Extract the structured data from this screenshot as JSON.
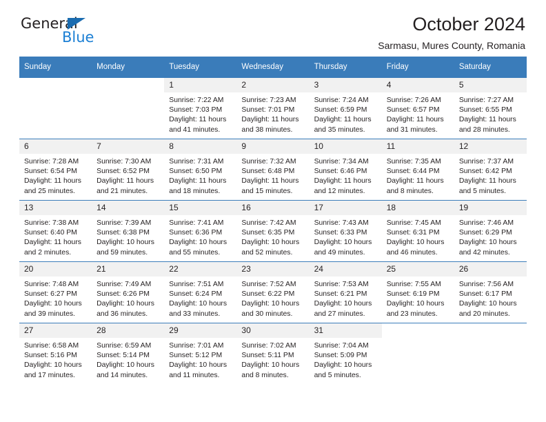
{
  "brand": {
    "name_part1": "General",
    "name_part2": "Blue",
    "triangle_color": "#1b6cb0",
    "blue_text_color": "#1b7fd4"
  },
  "header": {
    "title": "October 2024",
    "location": "Sarmasu, Mures County, Romania"
  },
  "theme": {
    "header_bg": "#3a7cba",
    "daynum_bg": "#f1f1f1",
    "grid_line": "#3a7cba",
    "text": "#231f20"
  },
  "calendar": {
    "weekday_headers": [
      "Sunday",
      "Monday",
      "Tuesday",
      "Wednesday",
      "Thursday",
      "Friday",
      "Saturday"
    ],
    "weeks": [
      [
        {
          "day": "",
          "blank": true,
          "lines": []
        },
        {
          "day": "",
          "blank": true,
          "lines": []
        },
        {
          "day": "1",
          "lines": [
            "Sunrise: 7:22 AM",
            "Sunset: 7:03 PM",
            "Daylight: 11 hours",
            "and 41 minutes."
          ]
        },
        {
          "day": "2",
          "lines": [
            "Sunrise: 7:23 AM",
            "Sunset: 7:01 PM",
            "Daylight: 11 hours",
            "and 38 minutes."
          ]
        },
        {
          "day": "3",
          "lines": [
            "Sunrise: 7:24 AM",
            "Sunset: 6:59 PM",
            "Daylight: 11 hours",
            "and 35 minutes."
          ]
        },
        {
          "day": "4",
          "lines": [
            "Sunrise: 7:26 AM",
            "Sunset: 6:57 PM",
            "Daylight: 11 hours",
            "and 31 minutes."
          ]
        },
        {
          "day": "5",
          "lines": [
            "Sunrise: 7:27 AM",
            "Sunset: 6:55 PM",
            "Daylight: 11 hours",
            "and 28 minutes."
          ]
        }
      ],
      [
        {
          "day": "6",
          "lines": [
            "Sunrise: 7:28 AM",
            "Sunset: 6:54 PM",
            "Daylight: 11 hours",
            "and 25 minutes."
          ]
        },
        {
          "day": "7",
          "lines": [
            "Sunrise: 7:30 AM",
            "Sunset: 6:52 PM",
            "Daylight: 11 hours",
            "and 21 minutes."
          ]
        },
        {
          "day": "8",
          "lines": [
            "Sunrise: 7:31 AM",
            "Sunset: 6:50 PM",
            "Daylight: 11 hours",
            "and 18 minutes."
          ]
        },
        {
          "day": "9",
          "lines": [
            "Sunrise: 7:32 AM",
            "Sunset: 6:48 PM",
            "Daylight: 11 hours",
            "and 15 minutes."
          ]
        },
        {
          "day": "10",
          "lines": [
            "Sunrise: 7:34 AM",
            "Sunset: 6:46 PM",
            "Daylight: 11 hours",
            "and 12 minutes."
          ]
        },
        {
          "day": "11",
          "lines": [
            "Sunrise: 7:35 AM",
            "Sunset: 6:44 PM",
            "Daylight: 11 hours",
            "and 8 minutes."
          ]
        },
        {
          "day": "12",
          "lines": [
            "Sunrise: 7:37 AM",
            "Sunset: 6:42 PM",
            "Daylight: 11 hours",
            "and 5 minutes."
          ]
        }
      ],
      [
        {
          "day": "13",
          "lines": [
            "Sunrise: 7:38 AM",
            "Sunset: 6:40 PM",
            "Daylight: 11 hours",
            "and 2 minutes."
          ]
        },
        {
          "day": "14",
          "lines": [
            "Sunrise: 7:39 AM",
            "Sunset: 6:38 PM",
            "Daylight: 10 hours",
            "and 59 minutes."
          ]
        },
        {
          "day": "15",
          "lines": [
            "Sunrise: 7:41 AM",
            "Sunset: 6:36 PM",
            "Daylight: 10 hours",
            "and 55 minutes."
          ]
        },
        {
          "day": "16",
          "lines": [
            "Sunrise: 7:42 AM",
            "Sunset: 6:35 PM",
            "Daylight: 10 hours",
            "and 52 minutes."
          ]
        },
        {
          "day": "17",
          "lines": [
            "Sunrise: 7:43 AM",
            "Sunset: 6:33 PM",
            "Daylight: 10 hours",
            "and 49 minutes."
          ]
        },
        {
          "day": "18",
          "lines": [
            "Sunrise: 7:45 AM",
            "Sunset: 6:31 PM",
            "Daylight: 10 hours",
            "and 46 minutes."
          ]
        },
        {
          "day": "19",
          "lines": [
            "Sunrise: 7:46 AM",
            "Sunset: 6:29 PM",
            "Daylight: 10 hours",
            "and 42 minutes."
          ]
        }
      ],
      [
        {
          "day": "20",
          "lines": [
            "Sunrise: 7:48 AM",
            "Sunset: 6:27 PM",
            "Daylight: 10 hours",
            "and 39 minutes."
          ]
        },
        {
          "day": "21",
          "lines": [
            "Sunrise: 7:49 AM",
            "Sunset: 6:26 PM",
            "Daylight: 10 hours",
            "and 36 minutes."
          ]
        },
        {
          "day": "22",
          "lines": [
            "Sunrise: 7:51 AM",
            "Sunset: 6:24 PM",
            "Daylight: 10 hours",
            "and 33 minutes."
          ]
        },
        {
          "day": "23",
          "lines": [
            "Sunrise: 7:52 AM",
            "Sunset: 6:22 PM",
            "Daylight: 10 hours",
            "and 30 minutes."
          ]
        },
        {
          "day": "24",
          "lines": [
            "Sunrise: 7:53 AM",
            "Sunset: 6:21 PM",
            "Daylight: 10 hours",
            "and 27 minutes."
          ]
        },
        {
          "day": "25",
          "lines": [
            "Sunrise: 7:55 AM",
            "Sunset: 6:19 PM",
            "Daylight: 10 hours",
            "and 23 minutes."
          ]
        },
        {
          "day": "26",
          "lines": [
            "Sunrise: 7:56 AM",
            "Sunset: 6:17 PM",
            "Daylight: 10 hours",
            "and 20 minutes."
          ]
        }
      ],
      [
        {
          "day": "27",
          "lines": [
            "Sunrise: 6:58 AM",
            "Sunset: 5:16 PM",
            "Daylight: 10 hours",
            "and 17 minutes."
          ]
        },
        {
          "day": "28",
          "lines": [
            "Sunrise: 6:59 AM",
            "Sunset: 5:14 PM",
            "Daylight: 10 hours",
            "and 14 minutes."
          ]
        },
        {
          "day": "29",
          "lines": [
            "Sunrise: 7:01 AM",
            "Sunset: 5:12 PM",
            "Daylight: 10 hours",
            "and 11 minutes."
          ]
        },
        {
          "day": "30",
          "lines": [
            "Sunrise: 7:02 AM",
            "Sunset: 5:11 PM",
            "Daylight: 10 hours",
            "and 8 minutes."
          ]
        },
        {
          "day": "31",
          "lines": [
            "Sunrise: 7:04 AM",
            "Sunset: 5:09 PM",
            "Daylight: 10 hours",
            "and 5 minutes."
          ]
        },
        {
          "day": "",
          "blank": true,
          "lines": []
        },
        {
          "day": "",
          "blank": true,
          "lines": []
        }
      ]
    ]
  }
}
